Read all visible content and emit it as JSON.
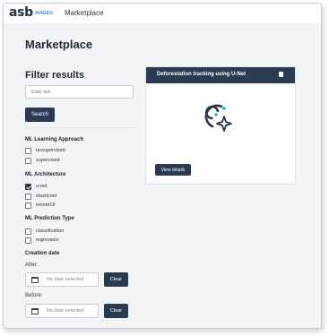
{
  "header": {
    "logo_text": "asb",
    "logo_sub": "AI4GEO",
    "title": "Marketplace"
  },
  "page": {
    "title": "Marketplace"
  },
  "filters": {
    "heading": "Filter results",
    "search_placeholder": "Enter text",
    "search_button": "Search",
    "groups": [
      {
        "title": "ML Learning Approach",
        "options": [
          {
            "label": "unsupervised",
            "checked": false
          },
          {
            "label": "supervised",
            "checked": false
          }
        ]
      },
      {
        "title": "ML Architecture",
        "options": [
          {
            "label": "u-net",
            "checked": true
          },
          {
            "label": "elasticnet",
            "checked": false
          },
          {
            "label": "resnet18",
            "checked": false
          }
        ]
      },
      {
        "title": "ML Prediction Type",
        "options": [
          {
            "label": "classification",
            "checked": false
          },
          {
            "label": "regression",
            "checked": false
          }
        ]
      }
    ],
    "creation_date": {
      "title": "Creation date",
      "after_label": "After:",
      "before_label": "Before:",
      "placeholder": "No date selected",
      "clear_label": "Clear"
    }
  },
  "card": {
    "title": "Deforestation tracking using U-Net",
    "view_button": "View details",
    "icon": "sparkle-spiral-icon",
    "accent": "#19b3a6",
    "ink": "#263549"
  }
}
